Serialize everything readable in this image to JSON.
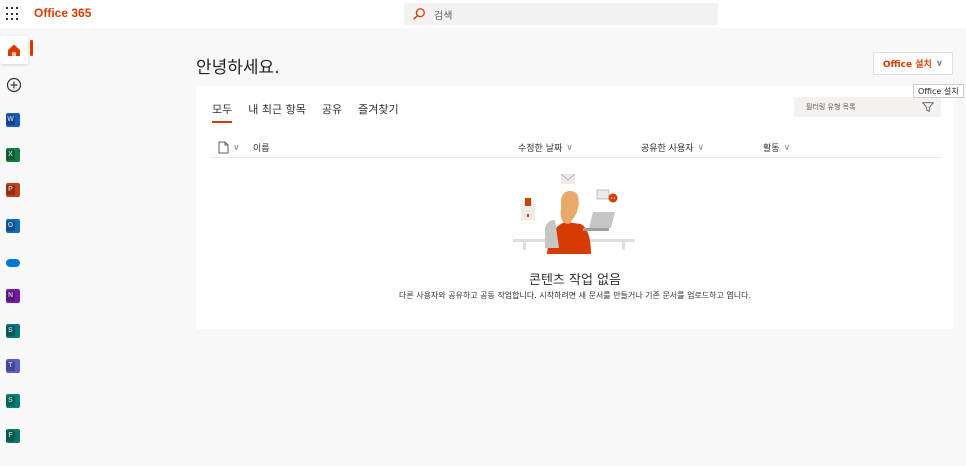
{
  "header": {
    "brand": "Office 365",
    "search_placeholder": "검색"
  },
  "rail": {
    "apps": [
      {
        "name": "Outlook",
        "letter": "W",
        "color": "#185abd"
      },
      {
        "name": "Excel",
        "letter": "X",
        "color": "#107c41"
      },
      {
        "name": "PowerPoint",
        "letter": "P",
        "color": "#c43e1c"
      },
      {
        "name": "Outlook",
        "letter": "O",
        "color": "#0f6cbd"
      },
      {
        "name": "OneDrive",
        "letter": "",
        "color": "#0078d4"
      },
      {
        "name": "OneNote",
        "letter": "N",
        "color": "#7719aa"
      },
      {
        "name": "SharePoint",
        "letter": "S",
        "color": "#03787c"
      },
      {
        "name": "Teams",
        "letter": "T",
        "color": "#5b5fc7"
      },
      {
        "name": "Sway",
        "letter": "S",
        "color": "#008272"
      },
      {
        "name": "Forms",
        "letter": "F",
        "color": "#077568"
      }
    ]
  },
  "main": {
    "greeting": "안녕하세요.",
    "install_label": "Office 설치",
    "install_tooltip": "Office 설치",
    "tabs": [
      {
        "label": "모두",
        "active": true
      },
      {
        "label": "내 최근 항목",
        "active": false
      },
      {
        "label": "공유",
        "active": false
      },
      {
        "label": "즐겨찾기",
        "active": false
      }
    ],
    "filter_placeholder": "필터링 유형 목록",
    "columns": {
      "name": "이름",
      "modified": "수정한 날짜",
      "shared_by": "공유한 사용자",
      "activity": "활동"
    },
    "empty_title": "콘텐츠 작업 없음",
    "empty_desc": "다른 사용자와 공유하고 공동 작업합니다. 시작하려면 새 문서를 만들거나 기존 문서를 업로드하고 엽니다."
  },
  "colors": {
    "accent": "#d83b01"
  }
}
